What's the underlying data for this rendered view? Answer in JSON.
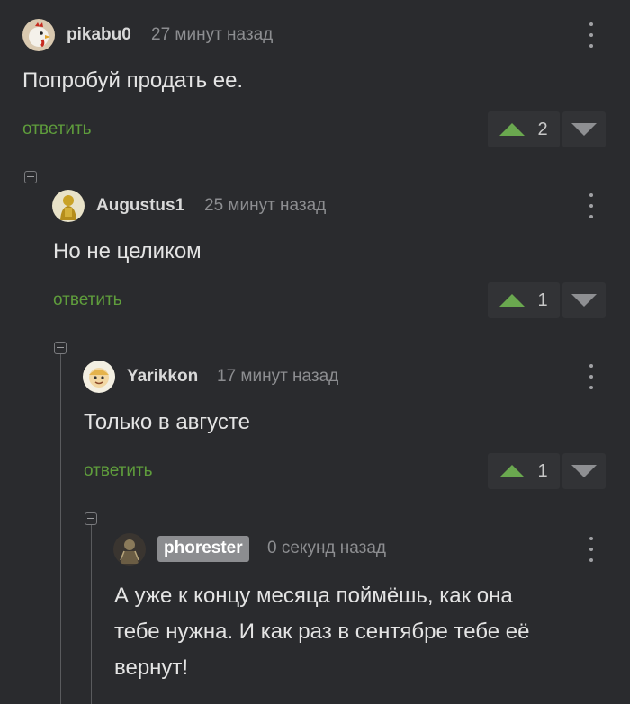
{
  "comments": [
    {
      "username": "pikabu0",
      "time": "27 минут назад",
      "text": "Попробуй продать ее.",
      "reply_label": "ответить",
      "rating": "2",
      "avatar_icon": "rooster-avatar-icon"
    },
    {
      "username": "Augustus1",
      "time": "25 минут назад",
      "text": "Но не целиком",
      "reply_label": "ответить",
      "rating": "1",
      "avatar_icon": "figure-avatar-icon"
    },
    {
      "username": "Yarikkon",
      "time": "17 минут назад",
      "text": "Только в августе",
      "reply_label": "ответить",
      "rating": "1",
      "avatar_icon": "cartoon-avatar-icon"
    },
    {
      "username": "phorester",
      "time": "0 секунд назад",
      "text_lines": [
        "А уже к концу месяца поймёшь, как она",
        "тебе нужна. И как раз в сентябре тебе её",
        "вернут!"
      ],
      "avatar_icon": "robot-avatar-icon"
    }
  ],
  "colors": {
    "background": "#2a2b2e",
    "reply_link": "#5f9d3c",
    "upvote": "#6aa84f",
    "highlight_badge": "#8c8d90"
  }
}
